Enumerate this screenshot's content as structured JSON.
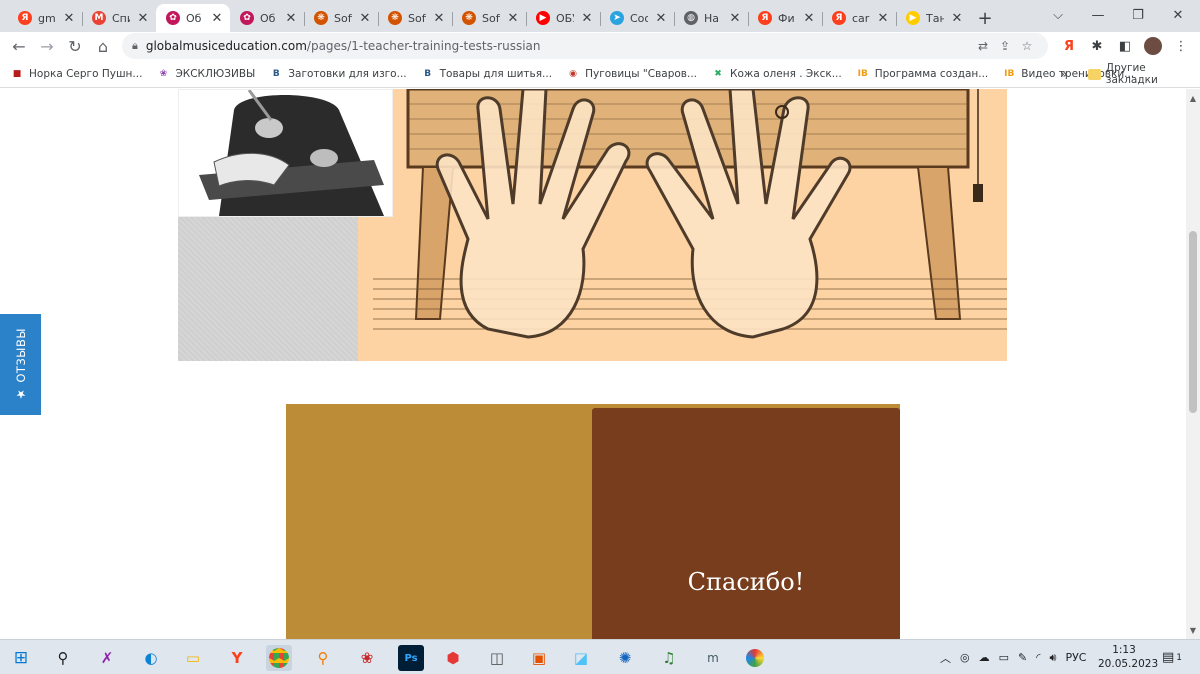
{
  "browser": {
    "tabs": [
      {
        "title": "gm",
        "icon": "yandex-icon",
        "glyph": "Я",
        "color": "#fc3f1d"
      },
      {
        "title": "Спи",
        "icon": "gmail-icon",
        "glyph": "M",
        "color": "#ea4335"
      },
      {
        "title": "Об",
        "icon": "site-favicon-icon",
        "glyph": "✿",
        "color": "#c2185b",
        "active": true
      },
      {
        "title": "Об",
        "icon": "site-favicon-icon",
        "glyph": "✿",
        "color": "#c2185b"
      },
      {
        "title": "Sofi",
        "icon": "sofi-icon",
        "glyph": "❋",
        "color": "#d35400"
      },
      {
        "title": "Sofi",
        "icon": "sofi-icon",
        "glyph": "❋",
        "color": "#d35400"
      },
      {
        "title": "Sofi",
        "icon": "sofi-icon",
        "glyph": "❋",
        "color": "#d35400"
      },
      {
        "title": "ОБУ",
        "icon": "youtube-icon",
        "glyph": "▶",
        "color": "#ff0000"
      },
      {
        "title": "Соо",
        "icon": "telegram-icon",
        "glyph": "➤",
        "color": "#2aa3df"
      },
      {
        "title": "На",
        "icon": "globe-icon",
        "glyph": "◍",
        "color": "#5f6368"
      },
      {
        "title": "Фи",
        "icon": "yandex-icon",
        "glyph": "Я",
        "color": "#fc3f1d"
      },
      {
        "title": "car",
        "icon": "yandex-icon",
        "glyph": "Я",
        "color": "#fc3f1d"
      },
      {
        "title": "Тан",
        "icon": "yandex-music-icon",
        "glyph": "▶",
        "color": "#ffcc00"
      }
    ],
    "new_tab": "+",
    "url_host": "globalmusiceducation.com",
    "url_path": "/pages/1-teacher-training-tests-russian",
    "bookmarks": [
      {
        "label": "Норка Серго Пушн...",
        "glyph": "■",
        "color": "#b71c1c"
      },
      {
        "label": "ЭКСКЛЮЗИВЫ",
        "glyph": "❀",
        "color": "#8e44ad"
      },
      {
        "label": "Заготовки для изго...",
        "glyph": "B",
        "color": "#2a5885"
      },
      {
        "label": "Товары для шитья...",
        "glyph": "B",
        "color": "#2a5885"
      },
      {
        "label": "Пуговицы \"Сваров...",
        "glyph": "◉",
        "color": "#c0392b"
      },
      {
        "label": "Кожа оленя . Экск...",
        "glyph": "✖",
        "color": "#27ae60"
      },
      {
        "label": "Программа создан...",
        "glyph": "IB",
        "color": "#f39c12"
      },
      {
        "label": "Видео тренировки...",
        "glyph": "IB",
        "color": "#f39c12"
      }
    ],
    "bookmarks_more": "»",
    "other_bookmarks": "Другие закладки"
  },
  "page": {
    "quote_text": "Спасибо!",
    "reviews_label": "★ ОТЗЫВЫ",
    "colors": {
      "hero_bg": "#fdd3a3",
      "quote_outer": "#bd8c36",
      "quote_inner": "#773d1c",
      "reviews_tab": "#2b82c9"
    }
  },
  "taskbar": {
    "language": "РУС",
    "time": "1:13",
    "date": "20.05.2023",
    "notifications": "1"
  }
}
